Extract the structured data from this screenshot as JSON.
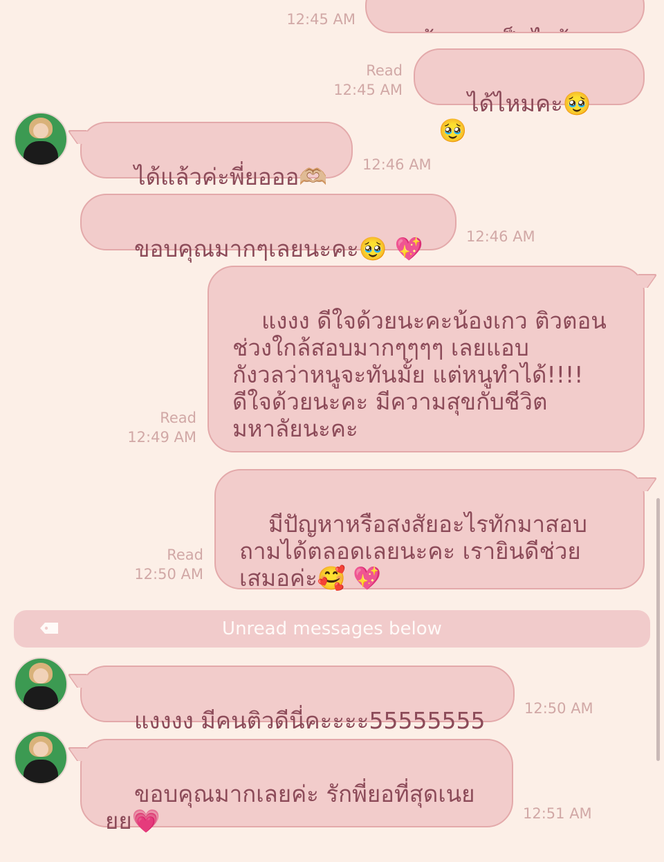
{
  "messages": [
    {
      "side": "out",
      "text": "น้องเกาเป็นไงบ้างลูก",
      "read": "",
      "time": "12:45 AM"
    },
    {
      "side": "out",
      "text": "ได้ไหมคะ🥹 🥹",
      "read": "Read",
      "time": "12:45 AM"
    },
    {
      "side": "in",
      "text": "ได้แล้วค่ะพี่ยอออ🫶🏼",
      "time": "12:46 AM"
    },
    {
      "side": "in",
      "text": "ขอบคุณมากๆเลยนะคะ🥹 💖",
      "time": "12:46 AM"
    },
    {
      "side": "out",
      "text": "แงงง ดีใจด้วยนะคะน้องเกว ติวตอน\nช่วงใกล้สอบมากๆๆๆๆ เลยแอบ\nกังวลว่าหนูจะทันมั้ย แต่หนูทำได้!!!!\nดีใจด้วยนะคะ มีความสุขกับชีวิต\nมหาลัยนะคะ",
      "read": "Read",
      "time": "12:49 AM"
    },
    {
      "side": "out",
      "text": "มีปัญหาหรือสงสัยอะไรทักมาสอบ\nถามได้ตลอดเลยนะคะ เรายินดีช่วย\nเสมอค่ะ🥰 💖",
      "read": "Read",
      "time": "12:50 AM"
    },
    {
      "side": "in",
      "text": "แงงงง มีคนติวดีนี่คะะะะ55555555",
      "time": "12:50 AM"
    },
    {
      "side": "in",
      "text": "ขอบคุณมากเลยค่ะ รักพี่ยอที่สุดเนย\nยย💗",
      "time": "12:51 AM"
    }
  ],
  "divider": {
    "label": "Unread messages below",
    "icon": "tag-icon"
  },
  "colors": {
    "background": "#fcefe7",
    "bubble": "#f2cccb",
    "bubble_border": "#e3a9aa",
    "text": "#8c4b59",
    "meta": "#d1a8a6"
  }
}
